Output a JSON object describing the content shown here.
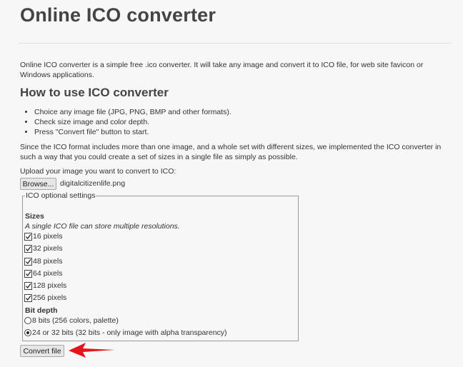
{
  "page": {
    "title": "Online ICO converter",
    "intro": "Online ICO converter is a simple free .ico converter. It will take any image and convert it to ICO file, for web site favicon or Windows applications.",
    "howto_heading": "How to use ICO converter",
    "steps": [
      "Choice any image file (JPG, PNG, BMP and other formats).",
      "Check size image and color depth.",
      "Press \"Convert file\" button to start."
    ],
    "para2": "Since the ICO format includes more than one image, and a whole set with different sizes, we implemented the ICO converter in such a way that you could create a set of sizes in a single file as simply as possible.",
    "upload_label": "Upload your image you want to convert to ICO:",
    "browse_label": "Browse...",
    "file_name": "digitalcitizenlife.png"
  },
  "settings": {
    "legend": "ICO optional settings",
    "sizes_heading": "Sizes",
    "sizes_note": "A single ICO file can store multiple resolutions.",
    "sizes": [
      {
        "label": "16 pixels",
        "checked": true
      },
      {
        "label": "32 pixels",
        "checked": true
      },
      {
        "label": "48 pixels",
        "checked": true
      },
      {
        "label": "64 pixels",
        "checked": true
      },
      {
        "label": "128 pixels",
        "checked": true
      },
      {
        "label": "256 pixels",
        "checked": true
      }
    ],
    "bit_heading": "Bit depth",
    "bit_options": [
      {
        "label": "8 bits (256 colors, palette)",
        "selected": false
      },
      {
        "label": "24 or 32 bits (32 bits - only image with alpha transparency)",
        "selected": true
      }
    ]
  },
  "actions": {
    "convert_label": "Convert file"
  },
  "colors": {
    "annotation_arrow": "#e8141b",
    "background": "#f7f7f7"
  }
}
